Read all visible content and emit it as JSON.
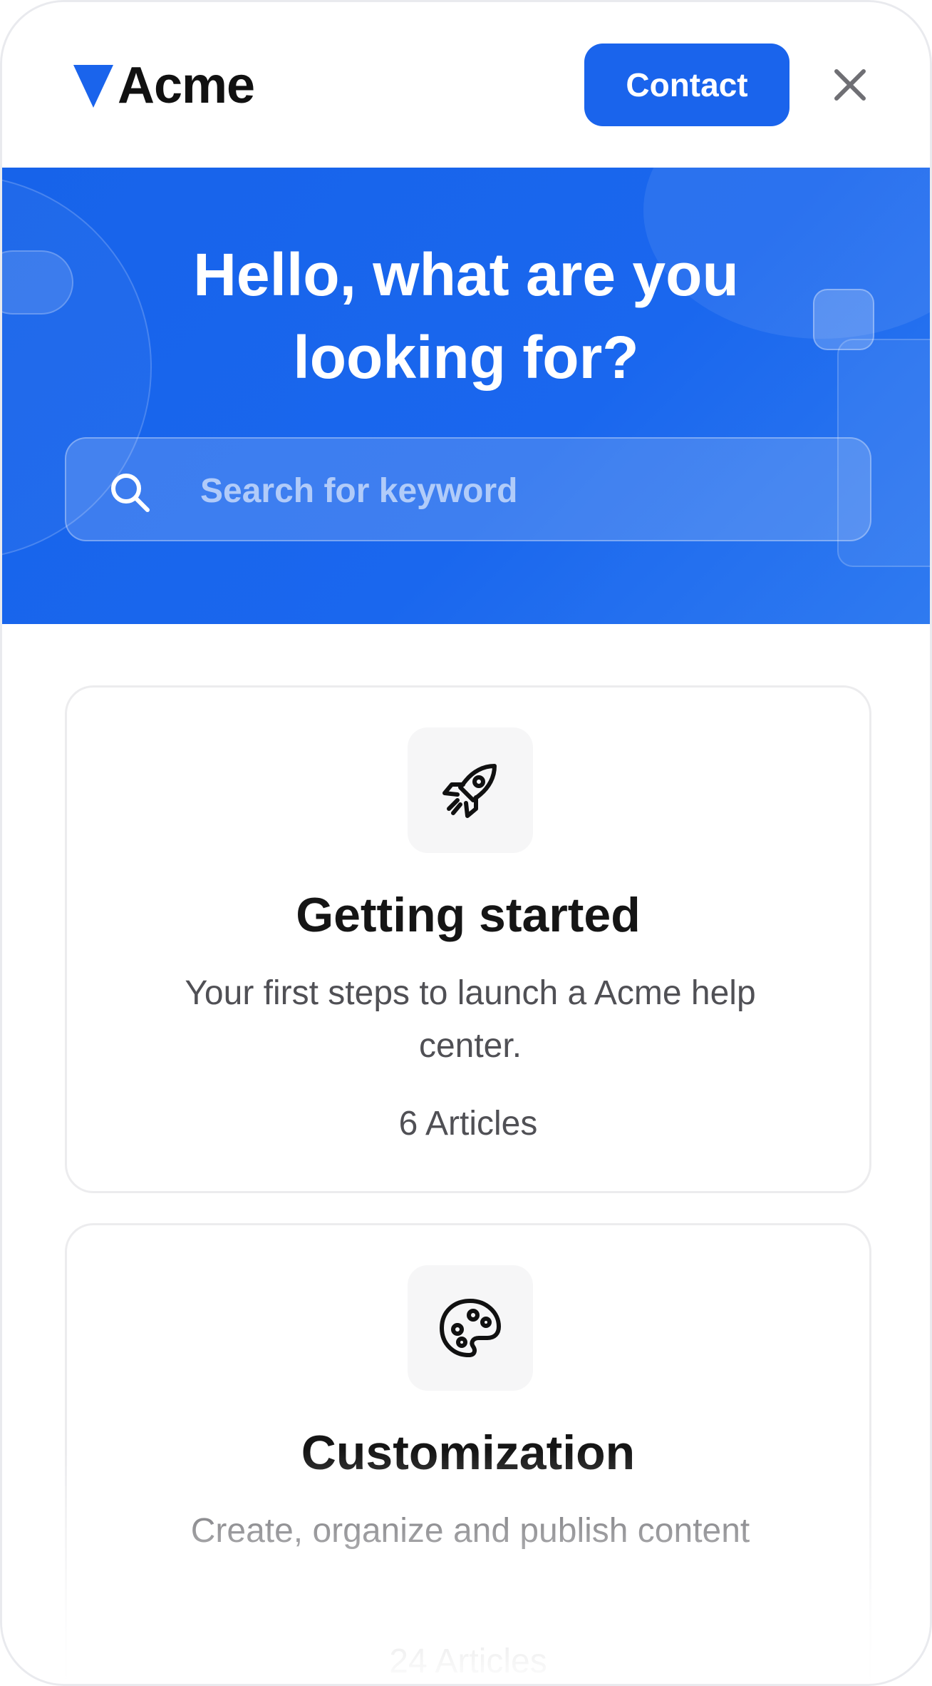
{
  "header": {
    "brand": "Acme",
    "contact_label": "Contact",
    "close_icon": "close-icon"
  },
  "hero": {
    "title_line1": "Hello, what are you",
    "title_line2": "looking for?",
    "search_placeholder": "Search for keyword",
    "search_value": ""
  },
  "cards": [
    {
      "icon": "rocket-icon",
      "title": "Getting started",
      "description": "Your first steps to launch a  Acme help center.",
      "count": "6 Articles"
    },
    {
      "icon": "palette-icon",
      "title": "Customization",
      "description": "Create, organize and publish content",
      "count": "24 Articles"
    }
  ],
  "colors": {
    "accent": "#1a64ec",
    "text_primary": "#151515",
    "text_secondary": "#505055",
    "card_border": "#ececee"
  }
}
